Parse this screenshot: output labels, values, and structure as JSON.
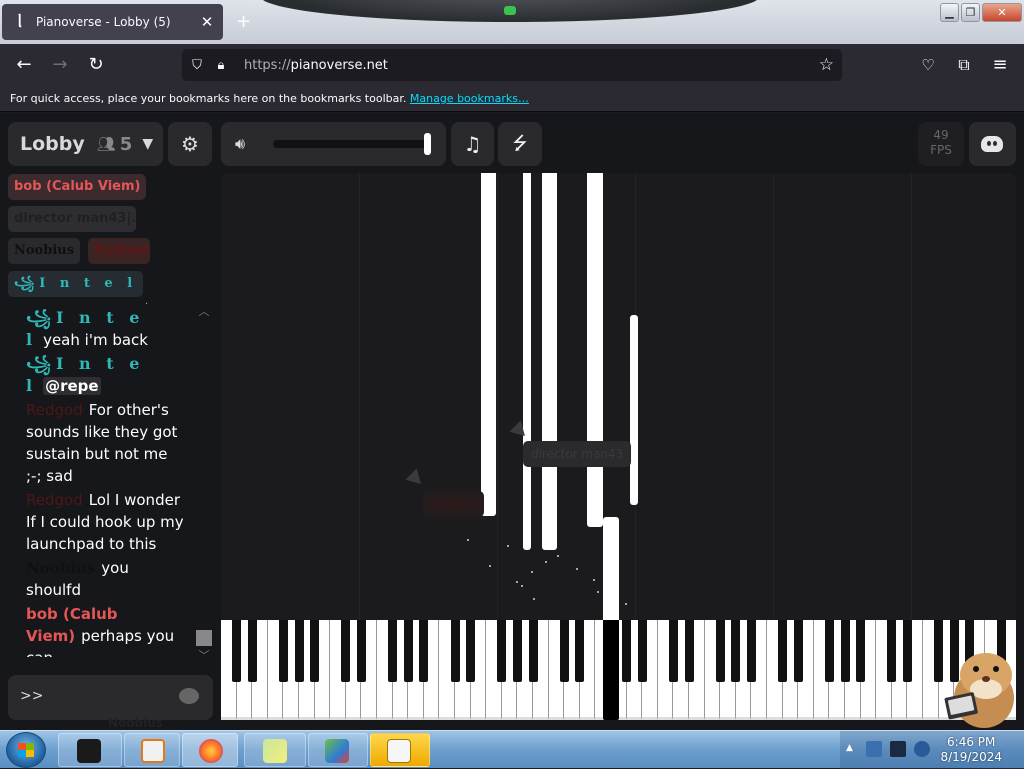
{
  "browser": {
    "tab_title": "Pianoverse - Lobby (5)",
    "tab_close": "✕",
    "new_tab": "+",
    "url_protocol": "https://",
    "url_host": "pianoverse.net",
    "bookmarks_text": "For quick access, place your bookmarks here on the bookmarks toolbar.",
    "bookmarks_link": "Manage bookmarks…"
  },
  "header": {
    "room_name": "Lobby",
    "user_count": "5",
    "fps_value": "49",
    "fps_label": "FPS"
  },
  "users": [
    {
      "name": "bob (Calub Viem)",
      "color": "#e55656"
    },
    {
      "name": "director man43|...",
      "color": "#202020"
    },
    {
      "name": "Noobius",
      "color": "#0f0f0f"
    },
    {
      "name": "Redgod",
      "color": "#5c1818"
    },
    {
      "name": "꧁I n t e l",
      "color": "#2fb8b8"
    }
  ],
  "chat": {
    "messages": [
      {
        "nick": "꧁I n t e l",
        "text": "yeah i'm back"
      },
      {
        "nick": "꧁I n t e l",
        "text": "@repe"
      },
      {
        "nick": "Redgod",
        "text": "For other's sounds like they got sustain but not me ;-; sad"
      },
      {
        "nick": "Redgod",
        "text": "Lol I wonder If I could hook up my launchpad to this"
      },
      {
        "nick": "Noobius",
        "text": "you shoulfd"
      },
      {
        "nick": "bob (Calub Viem)",
        "text": "perhaps you can"
      }
    ],
    "input_prompt": ">>",
    "ghost_tag": "Noobius"
  },
  "cursors": [
    {
      "name": "director man43"
    },
    {
      "name": "Redgod"
    }
  ],
  "taskbar": {
    "time": "6:46 PM",
    "date": "8/19/2024"
  },
  "icons": {
    "back": "back-arrow-icon",
    "forward": "forward-arrow-icon",
    "reload": "reload-icon",
    "shield": "shield-icon",
    "lock": "lock-icon",
    "star": "star-icon",
    "pocket": "pocket-icon",
    "extensions": "extensions-icon",
    "menu": "hamburger-menu-icon",
    "users": "users-icon",
    "settings": "gear-icon",
    "volume": "speaker-icon",
    "music": "music-note-icon",
    "midi": "usb-icon",
    "discord": "discord-icon",
    "chat": "chat-bubble-icon"
  },
  "colors": {
    "accent_cyan": "#00ddff",
    "background": "#16171a",
    "panel": "#2a2a2e"
  }
}
